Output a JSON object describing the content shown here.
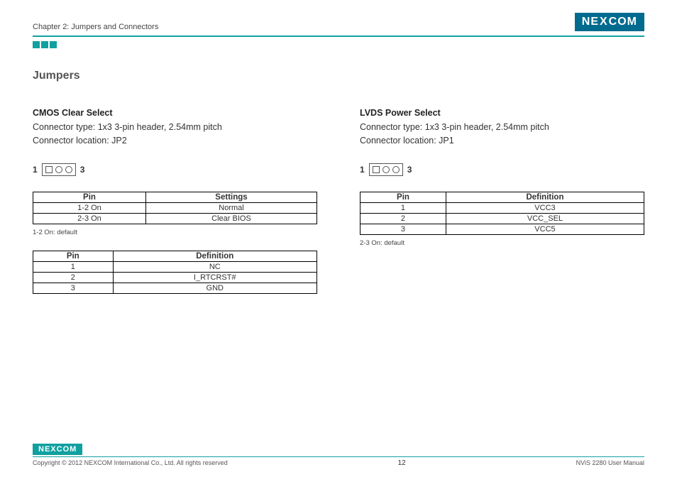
{
  "header": {
    "chapter": "Chapter 2: Jumpers and Connectors",
    "logo_text": "NEXCOM"
  },
  "section": {
    "title": "Jumpers"
  },
  "left": {
    "title": "CMOS Clear Select",
    "conn_type": "Connector type: 1x3 3-pin header, 2.54mm pitch",
    "conn_loc": "Connector location: JP2",
    "diagram": {
      "left_num": "1",
      "right_num": "3"
    },
    "table1": {
      "headers": [
        "Pin",
        "Settings"
      ],
      "rows": [
        [
          "1-2 On",
          "Normal"
        ],
        [
          "2-3 On",
          "Clear BIOS"
        ]
      ]
    },
    "note1": "1-2 On: default",
    "table2": {
      "headers": [
        "Pin",
        "Definition"
      ],
      "rows": [
        [
          "1",
          "NC"
        ],
        [
          "2",
          "I_RTCRST#"
        ],
        [
          "3",
          "GND"
        ]
      ]
    }
  },
  "right": {
    "title": "LVDS Power Select",
    "conn_type": "Connector type: 1x3 3-pin header, 2.54mm pitch",
    "conn_loc": "Connector location: JP1",
    "diagram": {
      "left_num": "1",
      "right_num": "3"
    },
    "table1": {
      "headers": [
        "Pin",
        "Definition"
      ],
      "rows": [
        [
          "1",
          "VCC3"
        ],
        [
          "2",
          "VCC_SEL"
        ],
        [
          "3",
          "VCC5"
        ]
      ]
    },
    "note1": "2-3 On: default"
  },
  "footer": {
    "logo_text": "NEXCOM",
    "copyright": "Copyright © 2012 NEXCOM International Co., Ltd. All rights reserved",
    "page": "12",
    "manual": "NViS 2280 User Manual"
  }
}
